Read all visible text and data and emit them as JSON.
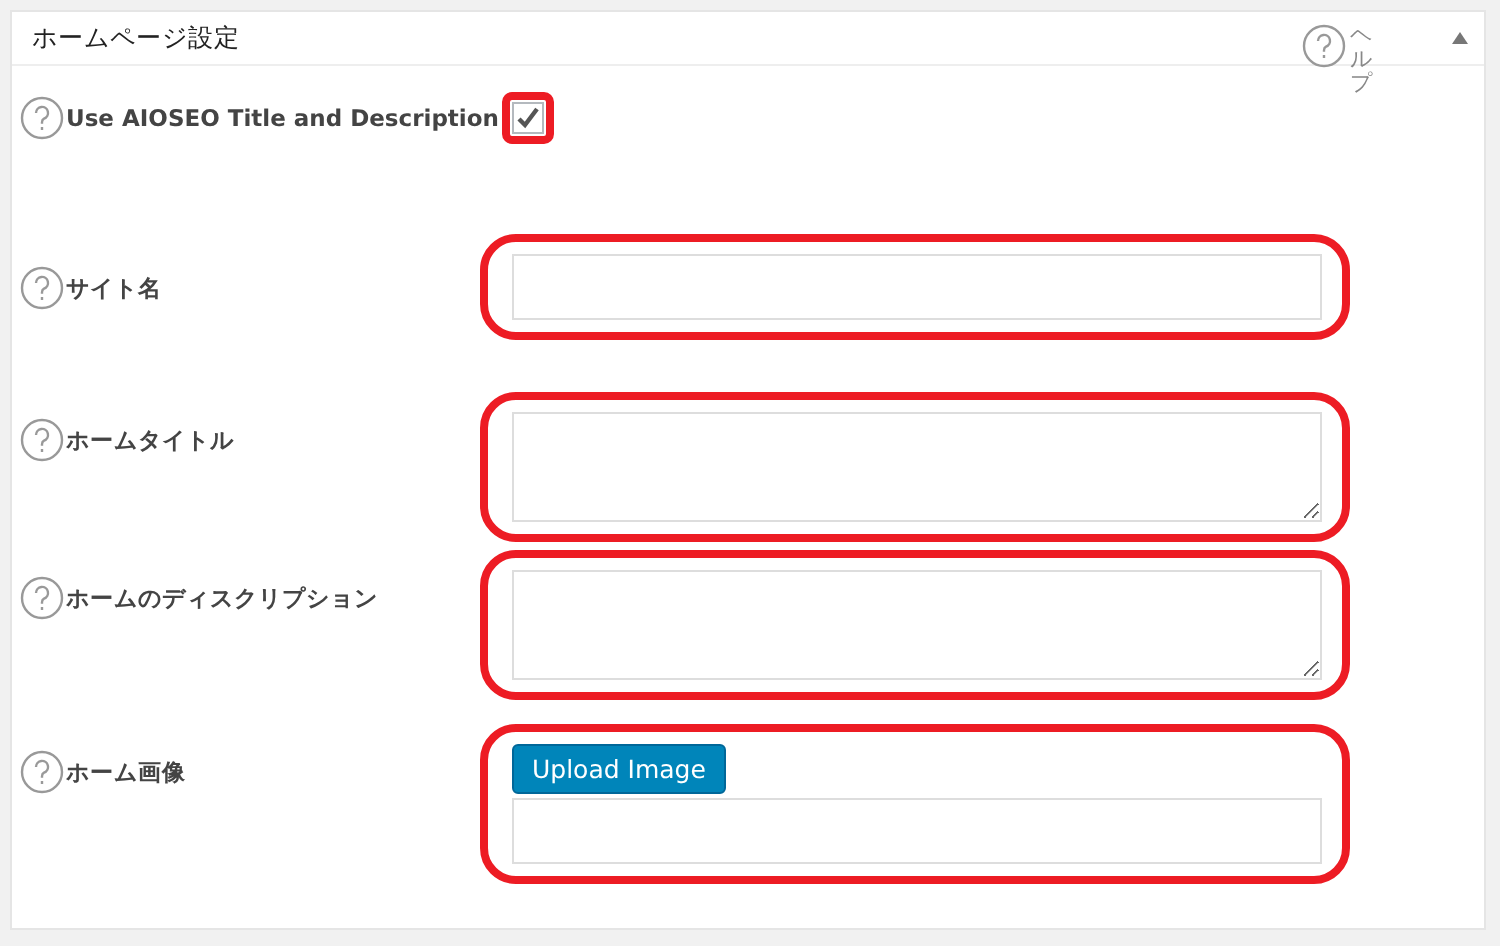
{
  "panel": {
    "title": "ホームページ設定",
    "help_label": "ヘルプ",
    "expanded": true
  },
  "rows": [
    {
      "kind": "checkbox",
      "label": "Use AIOSEO Title and Description",
      "checked": true,
      "highlighted": true
    },
    {
      "kind": "text",
      "label": "サイト名",
      "highlighted": true
    },
    {
      "kind": "textarea",
      "label": "ホームタイトル",
      "highlighted": true
    },
    {
      "kind": "textarea",
      "label": "ホームのディスクリプション",
      "highlighted": true
    },
    {
      "kind": "image",
      "label": "ホーム画像",
      "button": "Upload Image",
      "highlighted": true
    }
  ]
}
